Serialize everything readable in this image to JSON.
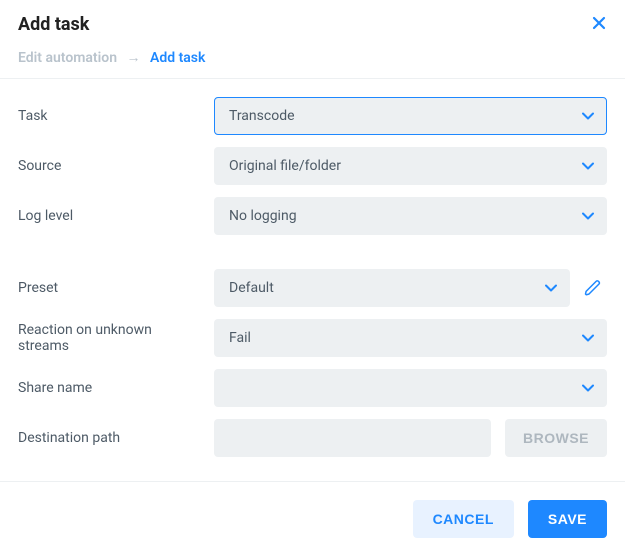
{
  "header": {
    "title": "Add task",
    "breadcrumb_prev": "Edit automation",
    "breadcrumb_current": "Add task"
  },
  "form": {
    "task": {
      "label": "Task",
      "value": "Transcode"
    },
    "source": {
      "label": "Source",
      "value": "Original file/folder"
    },
    "log_level": {
      "label": "Log level",
      "value": "No logging"
    },
    "preset": {
      "label": "Preset",
      "value": "Default"
    },
    "reaction": {
      "label": "Reaction on unknown streams",
      "value": "Fail"
    },
    "share_name": {
      "label": "Share name",
      "value": ""
    },
    "destination_path": {
      "label": "Destination path",
      "value": "",
      "browse_label": "BROWSE"
    }
  },
  "footer": {
    "cancel_label": "CANCEL",
    "save_label": "SAVE"
  }
}
